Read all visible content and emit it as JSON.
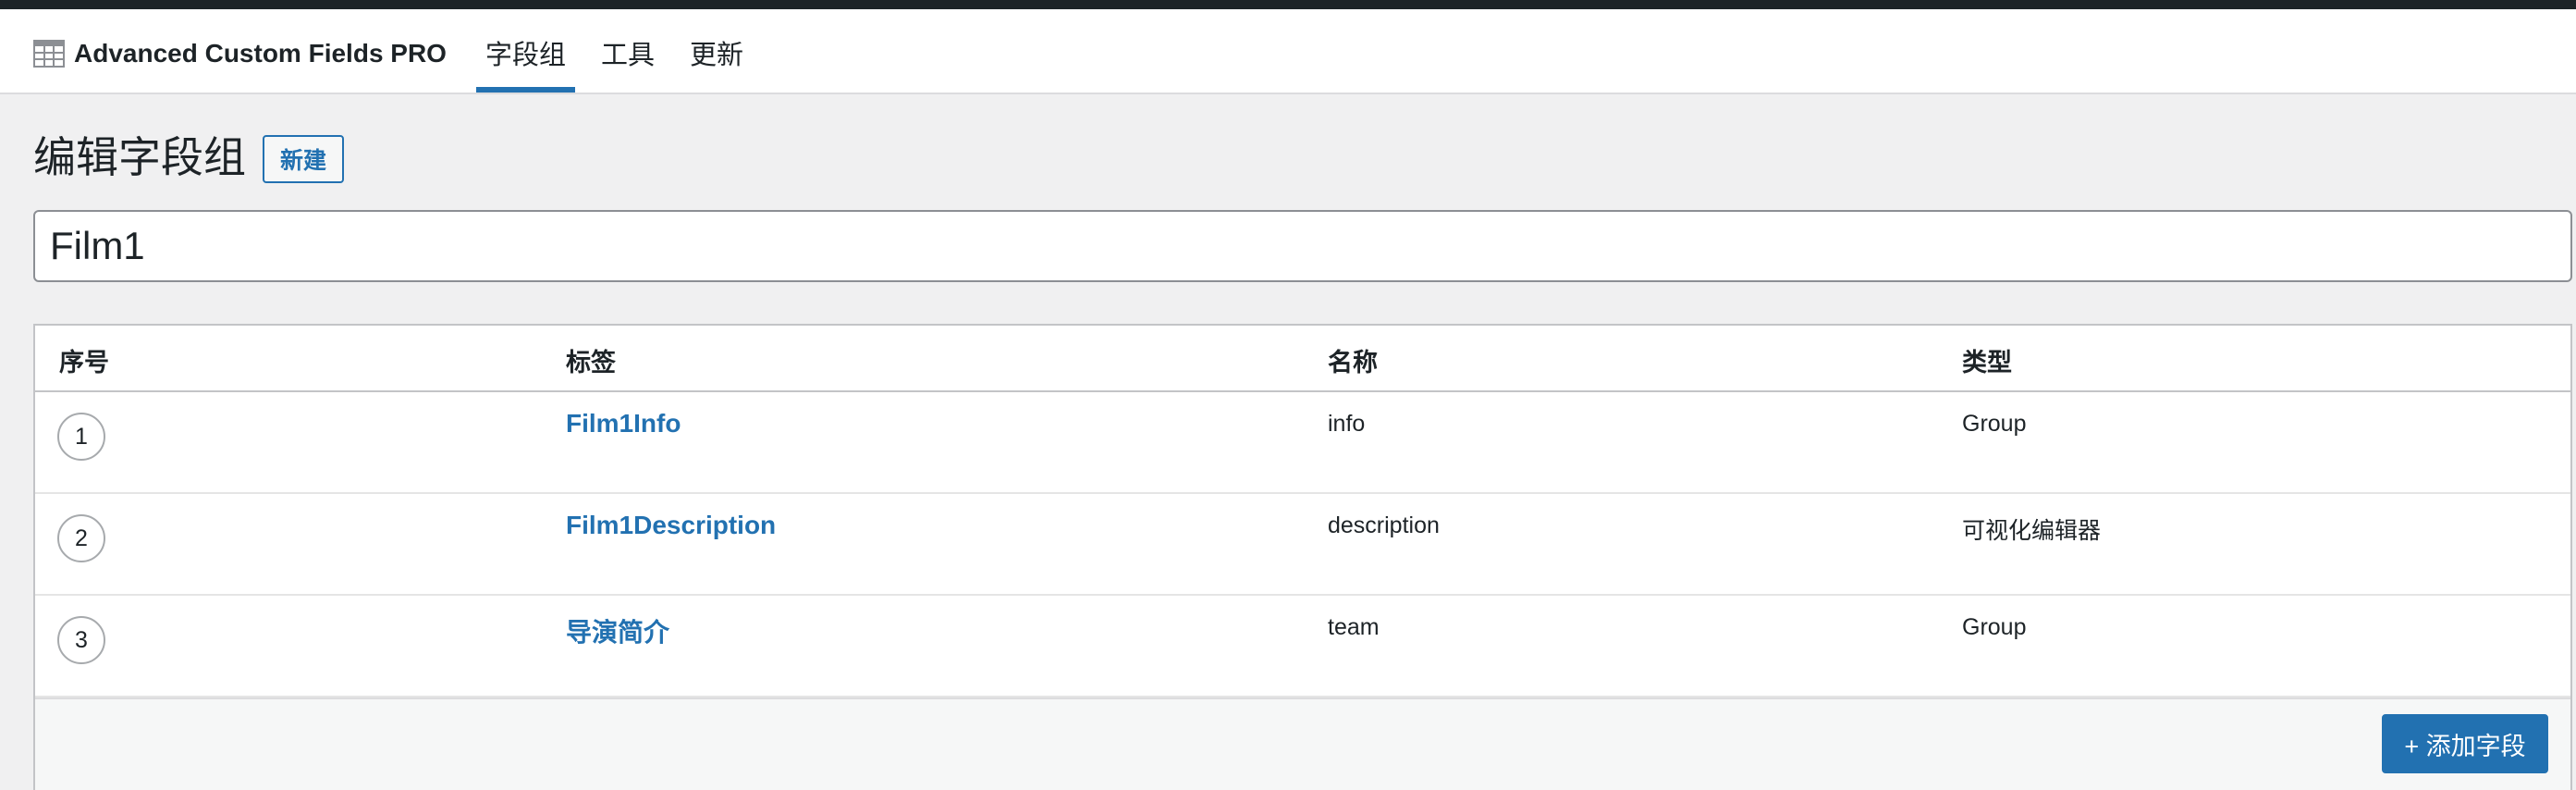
{
  "header": {
    "app_title": "Advanced Custom Fields PRO",
    "logo_icon": "acf-grid-icon",
    "tabs": [
      {
        "label": "字段组",
        "active": true
      },
      {
        "label": "工具",
        "active": false
      },
      {
        "label": "更新",
        "active": false
      }
    ]
  },
  "page": {
    "title": "编辑字段组",
    "new_button": "新建",
    "group_title_value": "Film1"
  },
  "fields_table": {
    "columns": [
      "序号",
      "标签",
      "名称",
      "类型"
    ],
    "rows": [
      {
        "order": "1",
        "label": "Film1Info",
        "name": "info",
        "type": "Group"
      },
      {
        "order": "2",
        "label": "Film1Description",
        "name": "description",
        "type": "可视化编辑器"
      },
      {
        "order": "3",
        "label": "导演简介",
        "name": "team",
        "type": "Group"
      }
    ],
    "add_field_button": "+ 添加字段"
  },
  "colors": {
    "accent": "#2271b1",
    "top_bar": "#1d2327",
    "background": "#f0f0f1"
  }
}
